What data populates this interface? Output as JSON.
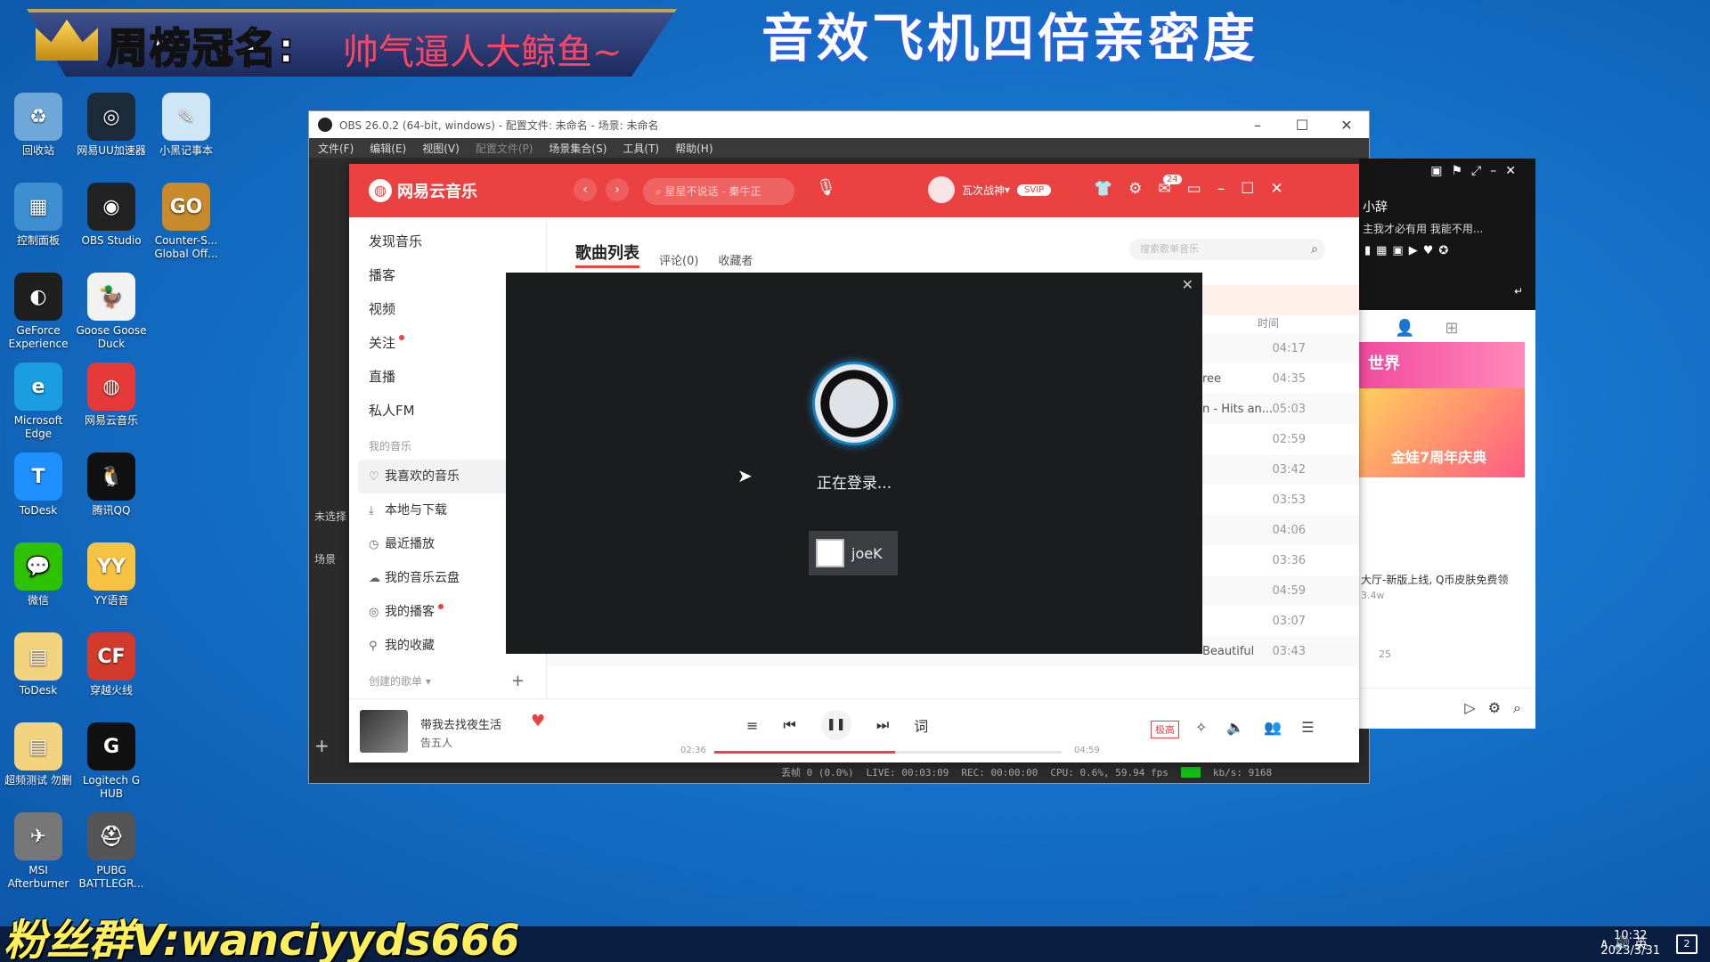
{
  "overlay": {
    "banner_title": "周榜冠名:",
    "banner_name": "帅气逼人大鲸鱼~",
    "top_caption": "音效飞机四倍亲密度",
    "bottom_caption": "粉丝群V:wanciyyds666"
  },
  "desktop_icons": [
    {
      "label": "回收站",
      "icon": "recycle-bin-icon",
      "color": "#6fa8d8",
      "glyph": "♻"
    },
    {
      "label": "网易UU加速器",
      "icon": "uu-booster-icon",
      "color": "#1b2b3a",
      "glyph": "◎"
    },
    {
      "label": "小黑记事本",
      "icon": "notepad-icon",
      "color": "#cfe6f7",
      "glyph": "✎"
    },
    {
      "label": "控制面板",
      "icon": "control-panel-icon",
      "color": "#3d8fd1",
      "glyph": "▦"
    },
    {
      "label": "OBS Studio",
      "icon": "obs-icon",
      "color": "#222",
      "glyph": "◉"
    },
    {
      "label": "Counter-S... Global Off...",
      "icon": "csgo-icon",
      "color": "#c88a2a",
      "glyph": "GO"
    },
    {
      "label": "GeForce Experience",
      "icon": "geforce-icon",
      "color": "#1f1f1f",
      "glyph": "◐"
    },
    {
      "label": "Goose Goose Duck",
      "icon": "goose-duck-icon",
      "color": "#f2f2f2",
      "glyph": "🦆"
    },
    {
      "label": "Microsoft Edge",
      "icon": "edge-icon",
      "color": "#1b9de2",
      "glyph": "e"
    },
    {
      "label": "网易云音乐",
      "icon": "netease-music-icon",
      "color": "#e63a3a",
      "glyph": "◍"
    },
    {
      "label": "ToDesk",
      "icon": "todesk-icon",
      "color": "#1e90ff",
      "glyph": "T"
    },
    {
      "label": "腾讯QQ",
      "icon": "qq-icon",
      "color": "#111",
      "glyph": "🐧"
    },
    {
      "label": "微信",
      "icon": "wechat-icon",
      "color": "#2dc100",
      "glyph": "💬"
    },
    {
      "label": "YY语音",
      "icon": "yy-icon",
      "color": "#f6c343",
      "glyph": "YY"
    },
    {
      "label": "ToDesk",
      "icon": "todesk-folder-icon",
      "color": "#f3d37d",
      "glyph": "▤"
    },
    {
      "label": "穿越火线",
      "icon": "crossfire-icon",
      "color": "#d23b2b",
      "glyph": "CF"
    },
    {
      "label": "超频测试 勿删",
      "icon": "folder-icon",
      "color": "#f3d37d",
      "glyph": "▤"
    },
    {
      "label": "Logitech G HUB",
      "icon": "logitech-icon",
      "color": "#111",
      "glyph": "G"
    },
    {
      "label": "MSI Afterburner",
      "icon": "msi-afterburner-icon",
      "color": "#777",
      "glyph": "✈"
    },
    {
      "label": "PUBG BATTLEGR...",
      "icon": "pubg-icon",
      "color": "#555",
      "glyph": "⛑"
    }
  ],
  "obs": {
    "title": "OBS 26.0.2 (64-bit, windows) - 配置文件: 未命名 - 场景: 未命名",
    "menu": [
      "文件(F)",
      "编辑(E)",
      "视图(V)",
      "配置文件(P)",
      "场景集合(S)",
      "工具(T)",
      "帮助(H)"
    ],
    "side_label_1": "未选择",
    "side_label_2": "场景",
    "status": {
      "dropped": "丢帧 0 (0.0%)",
      "live": "LIVE: 00:03:09",
      "rec": "REC: 00:00:00",
      "cpu": "CPU: 0.6%, 59.94 fps",
      "kbps": "kb/s: 9168"
    }
  },
  "netease": {
    "app_name": "网易云音乐",
    "search_placeholder": "星星不说话 - 秦牛正",
    "username": "瓦次战神",
    "vip_badge": "SVIP",
    "mail_count": "24",
    "sidebar": {
      "items": [
        "发现音乐",
        "播客",
        "视频",
        "关注",
        "直播",
        "私人FM"
      ],
      "my_music_header": "我的音乐",
      "my_items": [
        "我喜欢的音乐",
        "本地与下载",
        "最近播放",
        "我的音乐云盘",
        "我的播客",
        "我的收藏"
      ],
      "created_header": "创建的歌单"
    },
    "tabs": [
      "歌曲列表",
      "评论(0)",
      "收藏者"
    ],
    "list_search_placeholder": "搜索歌单音乐",
    "time_header": "时间",
    "rows": [
      {
        "album": "",
        "time": "04:17"
      },
      {
        "album": "ree",
        "time": "04:35"
      },
      {
        "album": "n - Hits an...",
        "time": "05:03"
      },
      {
        "album": "",
        "time": "02:59"
      },
      {
        "album": "",
        "time": "03:42"
      },
      {
        "album": "",
        "time": "03:53"
      },
      {
        "album": "",
        "time": "04:06"
      },
      {
        "album": "",
        "time": "03:36"
      },
      {
        "album": "",
        "time": "04:59"
      },
      {
        "album": "",
        "time": "03:07"
      },
      {
        "album": "Beautiful",
        "time": "03:43"
      }
    ],
    "player": {
      "song": "带我去找夜生活",
      "artist": "告五人",
      "current": "02:36",
      "total": "04:59",
      "progress": 0.52,
      "quality": "极高",
      "lyrics_btn": "词"
    }
  },
  "steam": {
    "status": "正在登录...",
    "username": "joeK"
  },
  "qq": {
    "name": "小辞",
    "signature": "主我才必有用 我能不用...",
    "ad1": "世界",
    "ad2": "金娃7周年庆典",
    "news": "大厅-新版上线, Q币皮肤免费领",
    "news_count": "3.4w",
    "stat": "25"
  },
  "taskbar": {
    "tray": "∧ 🔊 英",
    "time": "10:32",
    "date": "2023/3/31",
    "notifications": "2"
  }
}
